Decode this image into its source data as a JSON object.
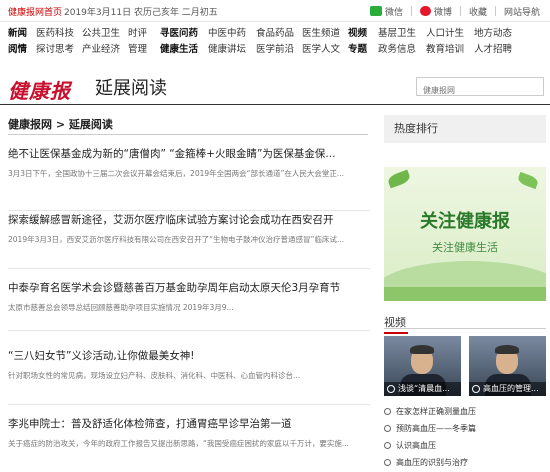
{
  "topbar": {
    "home_link": "健康报网首页",
    "date": "2019年3月11日 农历己亥年 二月初五",
    "wechat": "微信",
    "weibo": "微博",
    "favorite": "收藏",
    "site_nav": "网站导航"
  },
  "nav": {
    "row1": [
      "新闻",
      "医药科技",
      "公共卫生",
      "时评",
      "寻医问药",
      "中医中药",
      "食品药品",
      "医生频道",
      "视频",
      "基层卫生",
      "人口计生",
      "地方动态"
    ],
    "row2": [
      "阅情",
      "探讨思考",
      "产业经济",
      "管理",
      "健康生活",
      "健康讲坛",
      "医学前沿",
      "医学人文",
      "专题",
      "政务信息",
      "教育培训",
      "人才招聘"
    ]
  },
  "brand": {
    "logo": "健康报",
    "title": "延展阅读",
    "search_placeholder": "健康报网"
  },
  "breadcrumb": "健康报网 > 延展阅读",
  "articles": [
    {
      "title": "绝不让医保基金成为新的“唐僧肉” “金箍棒+火眼金睛”为医保基金保...",
      "desc": "3月3日下午，全国政协十三届二次会议开幕会结束后，2019年全国两会“部长通道”在人民大会堂正..."
    },
    {
      "title": "探索缓解感冒新途径，艾沥尔医疗临床试验方案讨论会成功在西安召开",
      "desc": "2019年3月3日，西安艾沥尔医疗科技有限公司在西安召开了“生物电子鼓冲仪治疗普通感冒”临床试..."
    },
    {
      "title": "中泰孕育名医学术会诊暨慈善百万基金助孕周年启动太原天伦3月孕育节",
      "desc": "太原市慈善总会领导总结回顾慈善助孕项目实施情况 2019年3月9..."
    },
    {
      "title": "“三八妇女节”义诊活动,让你做最美女神!",
      "desc": "针对职场女性的常见病，现场设立妇产科、皮肤科、消化科、中医科、心血管内科诊台..."
    },
    {
      "title": "李兆申院士：普及舒适化体检筛查，打通胃癌早诊早治第一道",
      "desc": "关于癌症的防治攻关，今年的政府工作报告又提出新思路，“我国受癌症困扰的家庭以千万计，要实施..."
    }
  ],
  "sidebar": {
    "hot_title": "热度排行",
    "banner_main": "关注健康报",
    "banner_sub": "关注健康生活",
    "video_title": "视频",
    "videos": [
      {
        "caption": "浅谈“清晨血..."
      },
      {
        "caption": "高血压的管理..."
      }
    ],
    "video_list": [
      "在家怎样正确测量血压",
      "预防高血压——冬季篇",
      "认识高血压",
      "高血压的识别与治疗"
    ]
  },
  "colors": {
    "brand_red": "#c8102e",
    "banner_green": "#2a7a2a",
    "wechat_green": "#2aae39",
    "weibo_red": "#e6162d"
  }
}
